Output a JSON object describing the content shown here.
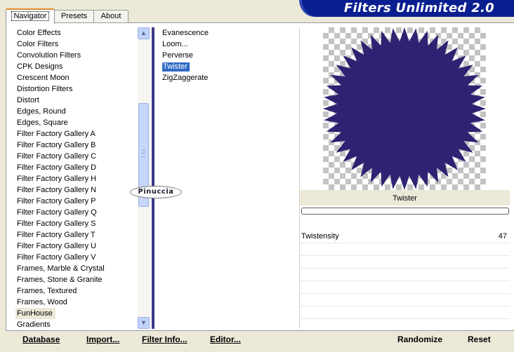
{
  "tabs": [
    {
      "label": "Navigator",
      "active": true
    },
    {
      "label": "Presets",
      "active": false
    },
    {
      "label": "About",
      "active": false
    }
  ],
  "header": {
    "title": "Filters Unlimited 2.0"
  },
  "categories": {
    "items": [
      "Color Effects",
      "Color Filters",
      "Convolution Filters",
      "CPK Designs",
      "Crescent Moon",
      "Distortion Filters",
      "Distort",
      "Edges, Round",
      "Edges, Square",
      "Filter Factory Gallery A",
      "Filter Factory Gallery B",
      "Filter Factory Gallery C",
      "Filter Factory Gallery D",
      "Filter Factory Gallery H",
      "Filter Factory Gallery N",
      "Filter Factory Gallery P",
      "Filter Factory Gallery Q",
      "Filter Factory Gallery S",
      "Filter Factory Gallery T",
      "Filter Factory Gallery U",
      "Filter Factory Gallery V",
      "Frames, Marble & Crystal",
      "Frames, Stone & Granite",
      "Frames, Textured",
      "Frames, Wood",
      "FunHouse",
      "Gradients"
    ],
    "selected": "FunHouse"
  },
  "filters": {
    "items": [
      "Evanescence",
      "Loom...",
      "Perverse",
      "Twister",
      "ZigZaggerate"
    ],
    "selected": "Twister"
  },
  "watermark": {
    "text": "Pinuccia"
  },
  "preview": {
    "filter_name": "Twister",
    "shape_color": "#2d2372",
    "progress": 0
  },
  "params": [
    {
      "label": "Twistensity",
      "value": "47"
    }
  ],
  "buttons": {
    "database": "Database",
    "import": "Import...",
    "filter_info": "Filter Info...",
    "editor": "Editor...",
    "randomize": "Randomize",
    "reset": "Reset"
  },
  "colors": {
    "accent": "#316ac5",
    "banner": "#0a1f8f",
    "tab_highlight": "#e68b2c"
  }
}
